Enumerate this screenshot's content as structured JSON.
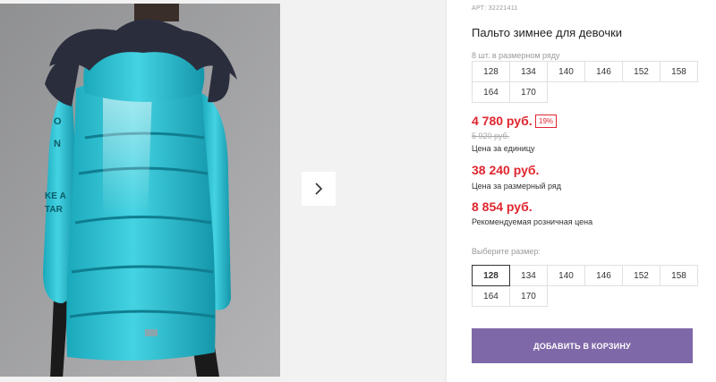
{
  "product": {
    "sku": "АРТ: 32221411",
    "title": "Пальто зимнее для девочки",
    "sizes_in_row_label": "8 шт. в размерном ряду",
    "sizes_row": [
      "128",
      "134",
      "140",
      "146",
      "152",
      "158",
      "164",
      "170"
    ],
    "price_unit": "4 780 руб.",
    "discount_badge": "19%",
    "price_old": "5 920 руб.",
    "price_unit_caption": "Цена за единицу",
    "price_row": "38 240 руб.",
    "price_row_caption": "Цена за размерный ряд",
    "price_retail": "8 854 руб.",
    "price_retail_caption": "Рекомендуемая розничная цена",
    "choose_size_label": "Выберите размер:",
    "size_options": [
      "128",
      "134",
      "140",
      "146",
      "152",
      "158",
      "164",
      "170"
    ],
    "selected_size": "128",
    "add_to_cart_label": "ДОБАВИТЬ В КОРЗИНУ"
  },
  "gallery": {
    "photo_icon": "jacket-photo",
    "next_icon": "chevron-right-icon",
    "jacket_text_1": "ΚΕ A",
    "jacket_text_2": "TAR",
    "jacket_text_3": "Ο",
    "jacket_text_4": "N"
  },
  "colors": {
    "price_red": "#e0262f",
    "button_purple": "#7f68a8",
    "jacket_turquoise": "#2ec3d4",
    "fur": "#2a2d3c"
  }
}
